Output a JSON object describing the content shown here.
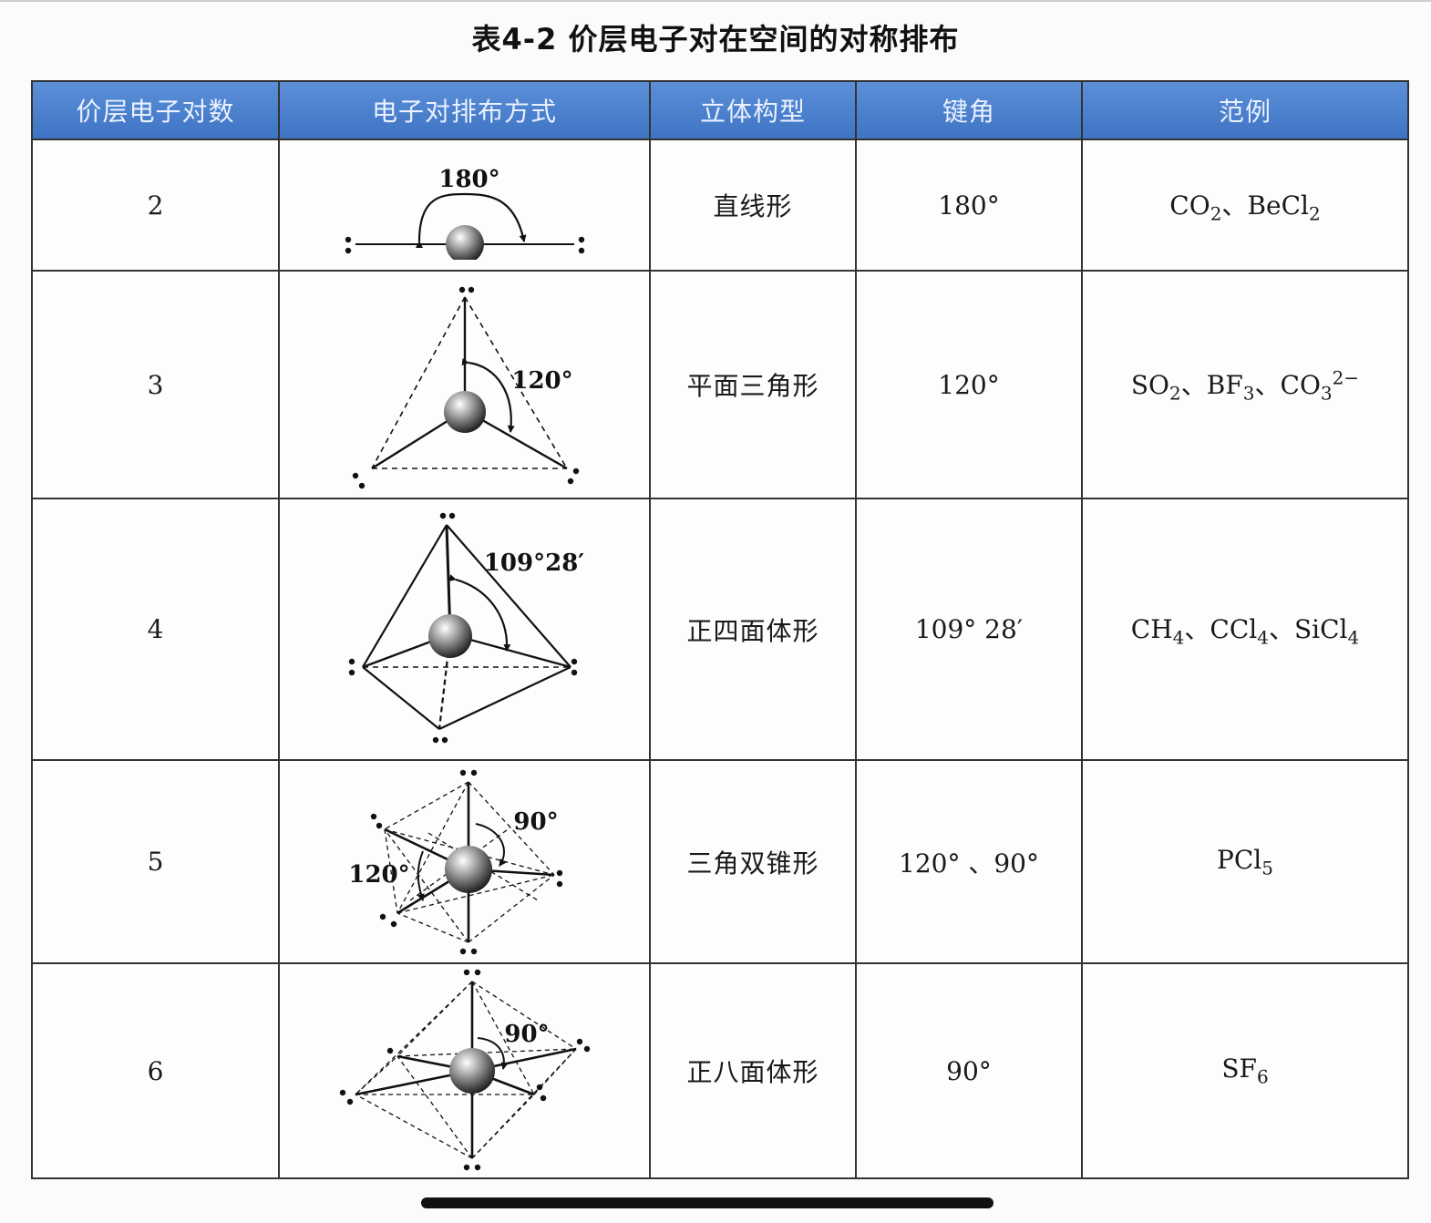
{
  "title": "表4-2 价层电子对在空间的对称排布",
  "headers": [
    "价层电子对数",
    "电子对排布方式",
    "立体构型",
    "键角",
    "范例"
  ],
  "rows": [
    {
      "pairs": "2",
      "diagram_label": "180°",
      "geometry": "直线形",
      "angle": "180°",
      "examples": [
        {
          "base": "CO",
          "sub": "2",
          "sup": "",
          "sep": "、"
        },
        {
          "base": "BeCl",
          "sub": "2",
          "sup": "",
          "sep": ""
        }
      ]
    },
    {
      "pairs": "3",
      "diagram_label": "120°",
      "geometry": "平面三角形",
      "angle": "120°",
      "examples": [
        {
          "base": "SO",
          "sub": "2",
          "sup": "",
          "sep": "、"
        },
        {
          "base": "BF",
          "sub": "3",
          "sup": "",
          "sep": "、"
        },
        {
          "base": "CO",
          "sub": "3",
          "sup": "2−",
          "sep": ""
        }
      ]
    },
    {
      "pairs": "4",
      "diagram_label": "109°28′",
      "geometry": "正四面体形",
      "angle": "109° 28′",
      "examples": [
        {
          "base": "CH",
          "sub": "4",
          "sup": "",
          "sep": "、"
        },
        {
          "base": "CCl",
          "sub": "4",
          "sup": "",
          "sep": "、"
        },
        {
          "base": "SiCl",
          "sub": "4",
          "sup": "",
          "sep": ""
        }
      ]
    },
    {
      "pairs": "5",
      "diagram_labels": [
        "90°",
        "120°"
      ],
      "geometry": "三角双锥形",
      "angle": "120° 、90°",
      "examples": [
        {
          "base": "PCl",
          "sub": "5",
          "sup": "",
          "sep": ""
        }
      ]
    },
    {
      "pairs": "6",
      "diagram_label": "90°",
      "geometry": "正八面体形",
      "angle": "90°",
      "examples": [
        {
          "base": "SF",
          "sub": "6",
          "sup": "",
          "sep": ""
        }
      ]
    }
  ],
  "colors": {
    "header_bg": "#4a80cf",
    "header_text": "#e9f1ff",
    "border": "#333333"
  }
}
